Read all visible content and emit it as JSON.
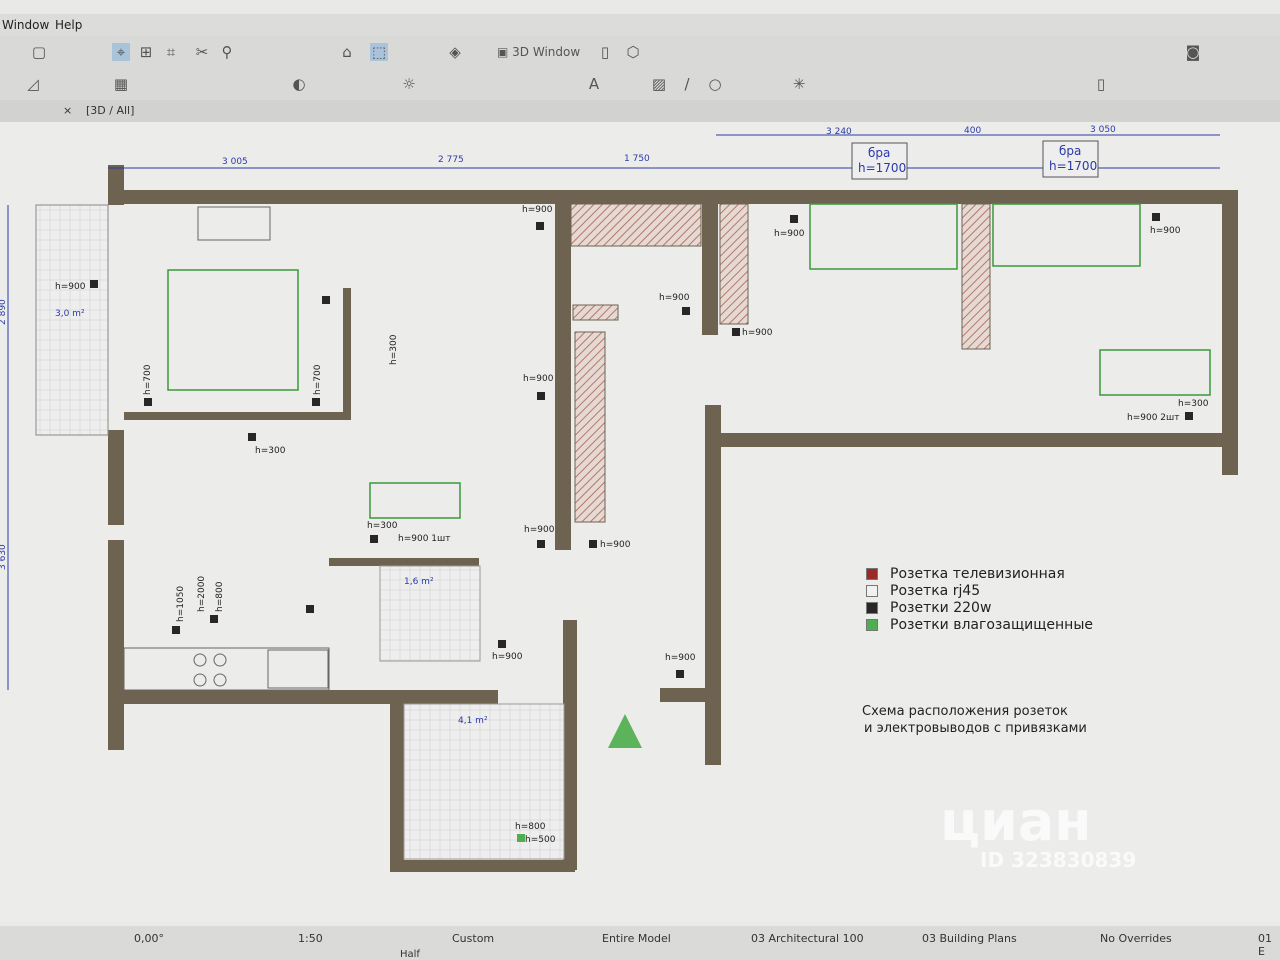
{
  "menu": {
    "items": [
      "Window",
      "Help"
    ]
  },
  "toolbar": {
    "window_3d_label": "3D Window"
  },
  "tab": {
    "label": "[3D / All]",
    "close": "×"
  },
  "plan": {
    "dimensions_top": [
      "3 005",
      "2 775",
      "1 750",
      "3 240",
      "400",
      "3 050"
    ],
    "dimensions_left": [
      "2 890",
      "3 630"
    ],
    "sconces": [
      {
        "label": "бра",
        "height": "h=1700"
      },
      {
        "label": "бра",
        "height": "h=1700"
      }
    ],
    "areas": [
      "3,0 m²",
      "1,6 m²",
      "4,1 m²"
    ],
    "outlet_labels": [
      "h=900",
      "h=900",
      "h=900",
      "h=900",
      "h=900",
      "h=900",
      "h=900",
      "h=900",
      "h=300",
      "h=300",
      "h=300",
      "h=700",
      "h=700",
      "h=900 1шт",
      "h=1050",
      "h=2000",
      "h=800",
      "h=800",
      "h=900",
      "h=900",
      "h=500",
      "h=900 2шт",
      "h=300",
      "h=900"
    ]
  },
  "legend": {
    "items": [
      {
        "label": "Розетка телевизионная",
        "color": "#9a2a2a"
      },
      {
        "label": "Розетка rj45",
        "color": "#f1f1ef"
      },
      {
        "label": "Розетки 220w",
        "color": "#2a2528"
      },
      {
        "label": "Розетки влагозащищенные",
        "color": "#4fae52"
      }
    ]
  },
  "caption": {
    "line1": "Схема расположения розеток",
    "line2": "и электровыводов  с привязками"
  },
  "watermark": {
    "text": "циан",
    "id": "ID 323830839"
  },
  "statusbar": {
    "angle": "0,00°",
    "scale": "1:50",
    "layer_combo": "Custom",
    "model": "Entire Model",
    "pen_set": "03 Architectural 100",
    "view": "03 Building Plans",
    "overrides": "No Overrides",
    "renovation": "01 E",
    "structure": "Half"
  },
  "colors": {
    "wall": "#6e6250",
    "dimension": "#2a3aa8",
    "hatch": "#b07a6a",
    "triangle": "#5db35a"
  }
}
